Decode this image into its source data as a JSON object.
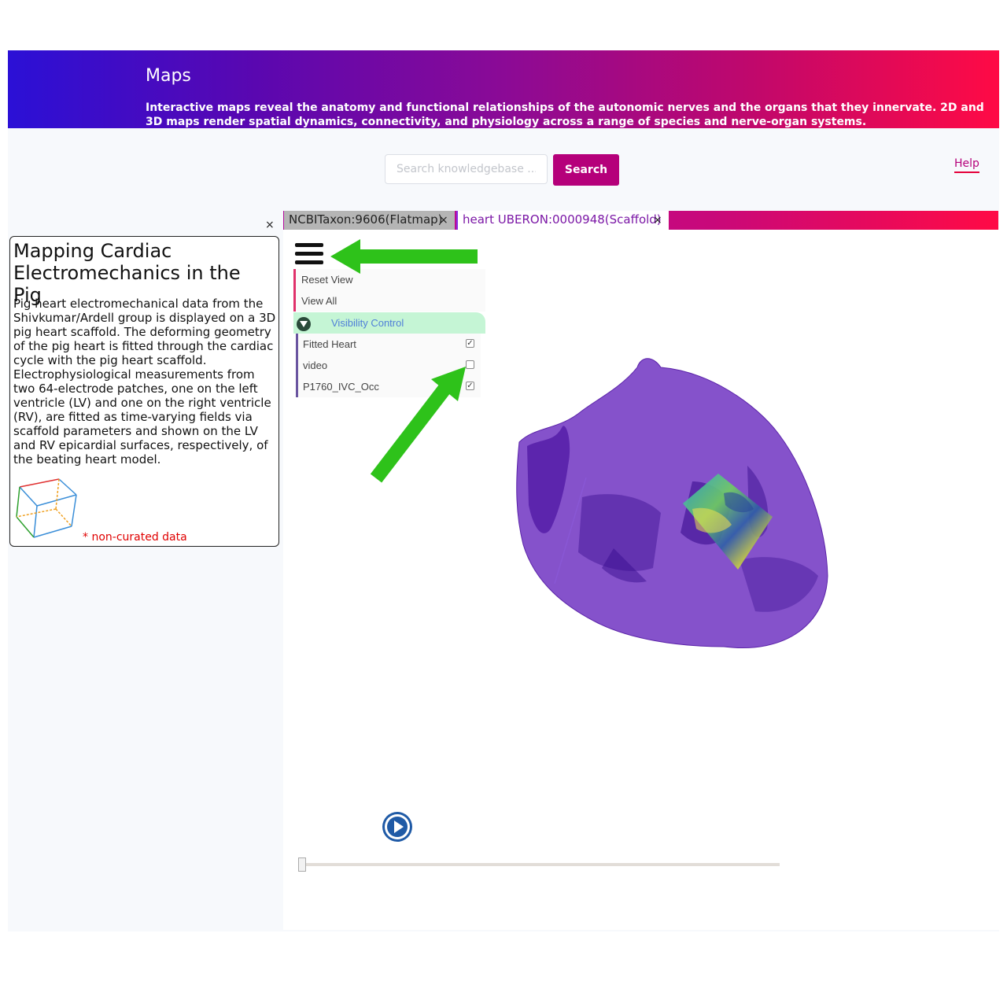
{
  "header": {
    "title": "Maps",
    "description": "Interactive maps reveal the anatomy and functional relationships of the autonomic nerves and the organs that they innervate. 2D and 3D maps render spatial dynamics, connectivity, and physiology across a range of species and nerve-organ systems."
  },
  "search": {
    "placeholder": "Search knowledgebase ...",
    "button_label": "Search"
  },
  "help_label": "Help",
  "tabs": [
    {
      "label": "NCBITaxon:9606(Flatmap)",
      "close": "×"
    },
    {
      "label": "heart UBERON:0000948(Scaffold)",
      "close": "×"
    }
  ],
  "info_panel": {
    "close": "×",
    "title": "Mapping Cardiac Electromechanics in the Pig",
    "body": "Pig heart electromechanical data from the Shivkumar/Ardell group is displayed on a 3D pig heart scaffold. The deforming geometry of the pig heart is fitted through the cardiac cycle with the pig heart scaffold. Electrophysiological measurements from two 64-electrode patches, one on the left ventricle (LV) and one on the right ventricle (RV), are fitted as time-varying fields via scaffold parameters and shown on the LV and RV epicardial surfaces, respectively, of the beating heart model.",
    "note": "* non-curated data"
  },
  "viewer_menu": {
    "reset_view": "Reset View",
    "view_all": "View All",
    "visibility_control": "Visibility Control",
    "items": [
      {
        "label": "Fitted Heart",
        "checked": true
      },
      {
        "label": "video",
        "checked": false
      },
      {
        "label": "P1760_IVC_Occ",
        "checked": true
      }
    ]
  },
  "playback": {
    "progress": 0.0
  },
  "colors": {
    "accent": "#b5007a",
    "heart": "#6a2cc0",
    "annotation_arrow": "#2ec21a"
  }
}
